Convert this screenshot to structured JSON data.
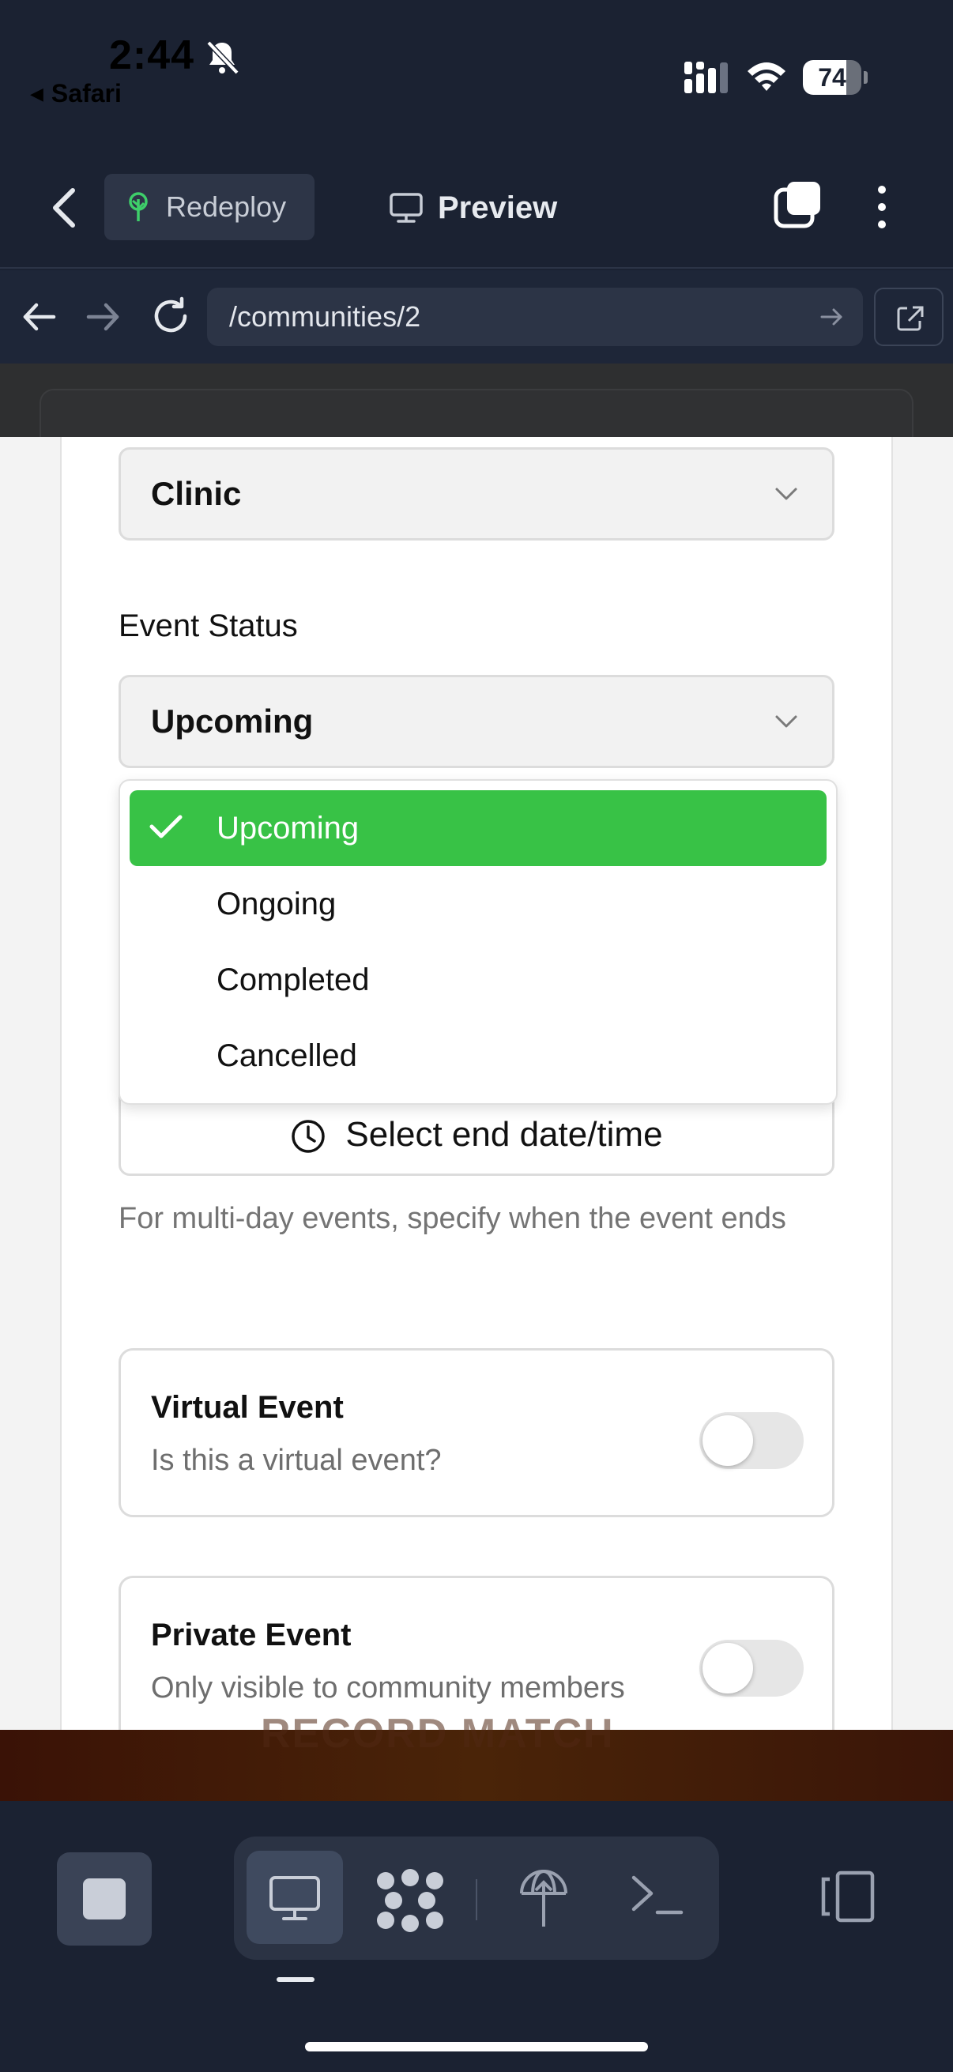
{
  "status_bar": {
    "time": "2:44",
    "back_app": "Safari",
    "battery": "74",
    "battery_level": 0.74
  },
  "toolbar": {
    "redeploy_label": "Redeploy",
    "preview_label": "Preview"
  },
  "browser": {
    "url": "/communities/2"
  },
  "form": {
    "category_value": "Clinic",
    "status_label": "Event Status",
    "status_value": "Upcoming",
    "status_options": [
      {
        "label": "Upcoming",
        "selected": true
      },
      {
        "label": "Ongoing",
        "selected": false
      },
      {
        "label": "Completed",
        "selected": false
      },
      {
        "label": "Cancelled",
        "selected": false
      }
    ],
    "end_date_button": "Select end date/time",
    "end_date_help": "For multi-day events, specify when the event ends",
    "virtual": {
      "title": "Virtual Event",
      "subtitle": "Is this a virtual event?",
      "on": false
    },
    "private": {
      "title": "Private Event",
      "subtitle": "Only visible to community members",
      "on": false
    }
  },
  "bottom_ghost": "RECORD MATCH",
  "colors": {
    "selected_option": "#38c246",
    "chrome": "#1b2232"
  },
  "icons": [
    "bell-off-icon",
    "signal-icon",
    "wifi-icon",
    "chevron-left-icon",
    "tree-icon",
    "monitor-icon",
    "tabs-icon",
    "more-vertical-icon",
    "arrow-left-icon",
    "arrow-right-icon",
    "reload-icon",
    "external-link-icon",
    "chevron-down-icon",
    "check-icon",
    "clock-icon",
    "stop-icon",
    "grid-icon",
    "globe-icon",
    "terminal-icon",
    "panel-icon"
  ]
}
